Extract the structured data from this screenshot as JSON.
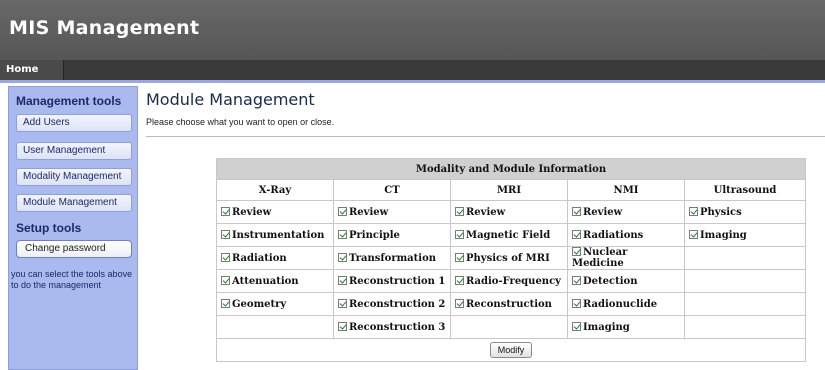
{
  "app": {
    "title": "MIS Management"
  },
  "nav": {
    "home": "Home"
  },
  "sidebar": {
    "management_heading": "Management tools",
    "management_items": [
      "Add Users",
      "User Management",
      "Modality Management",
      "Module Management"
    ],
    "setup_heading": "Setup tools",
    "setup_items": [
      "Change password"
    ],
    "note": "you can select the tools above to do the management"
  },
  "main": {
    "title": "Module Management",
    "instruction": "Please choose what you want to open or close."
  },
  "table": {
    "caption": "Modality and Module Information",
    "columns": [
      "X-Ray",
      "CT",
      "MRI",
      "NMI",
      "Ultrasound"
    ],
    "rows": [
      [
        "Review",
        "Review",
        "Review",
        "Review",
        "Physics"
      ],
      [
        "Instrumentation",
        "Principle",
        "Magnetic Field",
        "Radiations",
        "Imaging"
      ],
      [
        "Radiation",
        "Transformation",
        "Physics of MRI",
        "Nuclear Medicine",
        ""
      ],
      [
        "Attenuation",
        "Reconstruction 1",
        "Radio-Frequency",
        "Detection",
        ""
      ],
      [
        "Geometry",
        "Reconstruction 2",
        "Reconstruction",
        "Radionuclide",
        ""
      ],
      [
        "",
        "Reconstruction 3",
        "",
        "Imaging",
        ""
      ]
    ],
    "modify_label": "Modify"
  }
}
